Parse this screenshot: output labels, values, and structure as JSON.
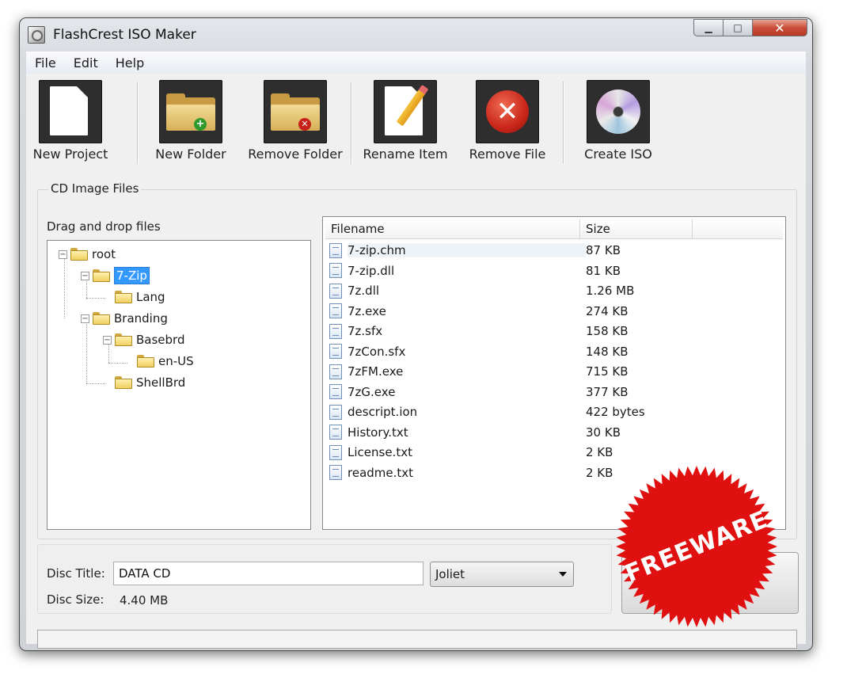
{
  "window": {
    "title": "FlashCrest ISO Maker",
    "caption": {
      "minimize": "▁",
      "maximize": "□",
      "close": "✕"
    }
  },
  "menu": [
    "File",
    "Edit",
    "Help"
  ],
  "toolbar": [
    {
      "label": "New Project",
      "icon": "new-page-icon"
    },
    {
      "label": "New Folder",
      "icon": "folder-add-icon"
    },
    {
      "label": "Remove Folder",
      "icon": "folder-remove-icon"
    },
    {
      "label": "Rename Item",
      "icon": "rename-pencil-icon"
    },
    {
      "label": "Remove File",
      "icon": "remove-x-icon"
    },
    {
      "label": "Create ISO",
      "icon": "disc-icon"
    }
  ],
  "group": {
    "label": "CD Image Files",
    "drag_label": "Drag and drop files"
  },
  "tree": [
    "root",
    "7-Zip",
    "Lang",
    "Branding",
    "Basebrd",
    "en-US",
    "ShellBrd"
  ],
  "tree_selected": "7-Zip",
  "filelist": {
    "columns": [
      "Filename",
      "Size"
    ],
    "rows": [
      {
        "name": "7-zip.chm",
        "size": "87 KB"
      },
      {
        "name": "7-zip.dll",
        "size": "81 KB"
      },
      {
        "name": "7z.dll",
        "size": "1.26 MB"
      },
      {
        "name": "7z.exe",
        "size": "274 KB"
      },
      {
        "name": "7z.sfx",
        "size": "158 KB"
      },
      {
        "name": "7zCon.sfx",
        "size": "148 KB"
      },
      {
        "name": "7zFM.exe",
        "size": "715 KB"
      },
      {
        "name": "7zG.exe",
        "size": "377 KB"
      },
      {
        "name": "descript.ion",
        "size": "422 bytes"
      },
      {
        "name": "History.txt",
        "size": "30 KB"
      },
      {
        "name": "License.txt",
        "size": "2 KB"
      },
      {
        "name": "readme.txt",
        "size": "2 KB"
      }
    ]
  },
  "disc": {
    "title_label": "Disc Title:",
    "title_value": "DATA CD",
    "size_label": "Disc Size:",
    "size_value": "4.40 MB",
    "filesystem": "Joliet"
  },
  "seal": {
    "text": "FREEWARE",
    "color": "#e01010"
  },
  "colors": {
    "selection": "#3399ff",
    "close_button": "#c94f3b"
  }
}
